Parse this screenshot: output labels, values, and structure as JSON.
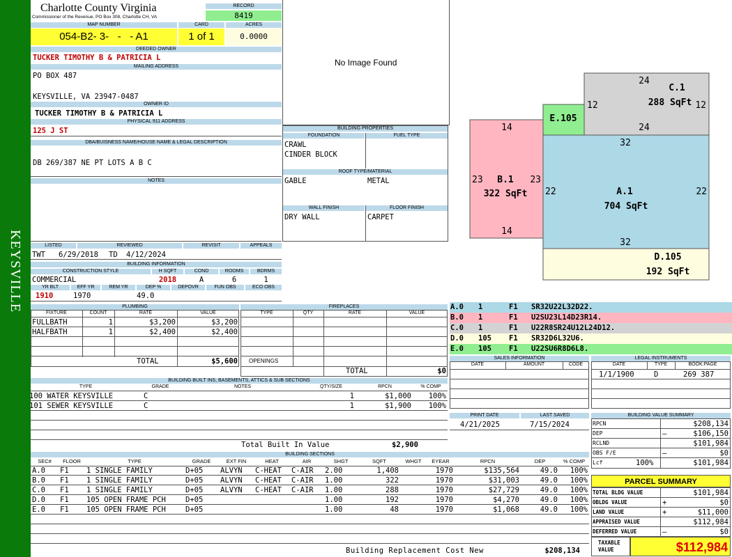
{
  "sidebar": {
    "label": "KEYSVILLE"
  },
  "header": {
    "county": "Charlotte County Virginia",
    "commissioner": "Commissioner of the Revenue, PO Box 308, Charlotte CH, VA",
    "record_label": "RECORD",
    "record": "8419",
    "map_label": "MAP NUMBER",
    "map_number": "054-B2- 3-   -   - A1",
    "card_label": "CARD",
    "card": "1 of 1",
    "acres_label": "ACRES",
    "acres": "0.0000"
  },
  "owner": {
    "deeded_label": "DEEDED OWNER",
    "deeded": "TUCKER TIMOTHY B & PATRICIA L",
    "mailing_label": "MAILING ADDRESS",
    "mailing_line1": "PO BOX 487",
    "mailing_line2": "KEYSVILLE, VA 23947-0487",
    "owner_id_label": "OWNER ID",
    "owner_id": "TUCKER TIMOTHY B & PATRICIA L",
    "physical_label": "PHYSICAL 911 ADDRESS",
    "physical": "125 J ST"
  },
  "legal": {
    "label": "DBA/BUISNESS NAME/HOUSE NAME & LEGAL DESCRIPTION",
    "text": "DB 269/387 NE PT LOTS A B C",
    "notes_label": "NOTES"
  },
  "photo": {
    "text": "No Image Found"
  },
  "building_props": {
    "label": "BUILDING PROPERTIES",
    "foundation_label": "FOUNDATION",
    "fuel_label": "FUEL TYPE",
    "foundation1": "CRAWL",
    "foundation2": "CINDER BLOCK",
    "roof_label": "ROOF TYPE/MATERIAL",
    "roof_type": "GABLE",
    "roof_material": "METAL",
    "wall_label": "WALL FINISH",
    "floor_label": "FLOOR FINISH",
    "wall": "DRY WALL",
    "floor": "CARPET"
  },
  "listed": {
    "listed_label": "LISTED",
    "reviewed_label": "REVIEWED",
    "revisit_label": "REVISIT",
    "appeals_label": "APPEALS",
    "listed_by": "TWT",
    "listed_date": "6/29/2018",
    "reviewed_by": "TD",
    "reviewed_date": "4/12/2024"
  },
  "building_info": {
    "label": "BUILDING INFORMATION",
    "style_label": "CONSTRUCTION STYLE",
    "hsqft_label": "H SQFT",
    "cond_label": "COND",
    "rooms_label": "ROOMS",
    "bdrms_label": "BDRMS",
    "style": "COMMERCIAL",
    "hsqft": "2018",
    "cond": "A",
    "rooms": "6",
    "bdrms": "1",
    "yrblt_label": "YR BLT",
    "effyr_label": "EFF YR",
    "remyr_label": "REM YR",
    "dep_label": "DEP %",
    "depovr_label": "DEPOVR",
    "funobs_label": "FUN OBS",
    "ecoobs_label": "ECO OBS",
    "yrblt": "1910",
    "effyr": "1970",
    "dep": "49.0"
  },
  "plumbing": {
    "label": "PLUMBING",
    "headers": [
      "FIXTURE",
      "COUNT",
      "RATE",
      "VALUE"
    ],
    "rows": [
      [
        "FULLBATH",
        "1",
        "$3,200",
        "$3,200"
      ],
      [
        "HALFBATH",
        "1",
        "$2,400",
        "$2,400"
      ]
    ],
    "total_label": "TOTAL",
    "total": "$5,600"
  },
  "fireplaces": {
    "label": "FIREPLACES",
    "headers": [
      "TYPE",
      "QTY",
      "RATE",
      "VALUE"
    ],
    "openings_label": "OPENINGS",
    "total_label": "TOTAL",
    "total": "$0"
  },
  "built_ins": {
    "label": "BUILDING BUILT INS, BASEMENTS, ATTICS & SUB SECTIONS",
    "headers": [
      "TYPE",
      "GRADE",
      "NOTES",
      "QTY/SIZE",
      "RPCN",
      "% COMP"
    ],
    "rows": [
      [
        "100 WATER KEYSVILLE",
        "C",
        "",
        "1",
        "$1,000",
        "100%"
      ],
      [
        "101 SEWER KEYSVILLE",
        "C",
        "",
        "1",
        "$1,900",
        "100%"
      ]
    ],
    "total_label": "Total Built In Value",
    "total": "$2,900"
  },
  "sketch": {
    "sections": [
      {
        "label": "A.1",
        "area": "704 SqFt",
        "top": "32",
        "bottom": "32",
        "left": "22",
        "right": "22",
        "color": "#add8e6"
      },
      {
        "label": "B.1",
        "area": "322 SqFt",
        "top": "14",
        "bottom": "14",
        "left": "23",
        "right": "23",
        "color": "#ffb6c1"
      },
      {
        "label": "C.1",
        "area": "288 SqFt",
        "top": "24",
        "bottom": "24",
        "left": "12",
        "right": "12",
        "color": "#d3d3d3"
      },
      {
        "label": "D.105",
        "area": "192 SqFt",
        "color": "#fffde0"
      },
      {
        "label": "E.105",
        "area": "",
        "color": "#90ee90"
      }
    ]
  },
  "sketch_legend": [
    {
      "code": "A.0",
      "n": "1",
      "f": "F1",
      "desc": "SR32U22L32D22.",
      "color": "#add8e6"
    },
    {
      "code": "B.0",
      "n": "1",
      "f": "F1",
      "desc": "U2SU23L14D23R14.",
      "color": "#ffb6c1"
    },
    {
      "code": "C.0",
      "n": "1",
      "f": "F1",
      "desc": "U22R8SR24U12L24D12.",
      "color": "#d3d3d3"
    },
    {
      "code": "D.0",
      "n": "105",
      "f": "F1",
      "desc": "SR32D6L32U6.",
      "color": "#fffde0"
    },
    {
      "code": "E.0",
      "n": "105",
      "f": "F1",
      "desc": "U22SU6R8D6L8.",
      "color": "#90ee90"
    }
  ],
  "sales": {
    "label": "SALES INFORMATION",
    "headers": [
      "DATE",
      "AMOUNT",
      "CODE"
    ]
  },
  "legal_instruments": {
    "label": "LEGAL INSTRUMENTS",
    "headers": [
      "DATE",
      "TYPE",
      "BOOK:PAGE"
    ],
    "date": "1/1/1900",
    "type": "D",
    "bookpage": "269 387"
  },
  "dates": {
    "print_label": "PRINT DATE",
    "saved_label": "LAST SAVED",
    "print": "4/21/2025",
    "saved": "7/15/2024"
  },
  "value_summary": {
    "label": "BUILDING VALUE SUMMARY",
    "rpcn_label": "RPCN",
    "rpcn": "$208,134",
    "dep_label": "DEP",
    "dep_sign": "–",
    "dep": "$106,150",
    "rclnd_label": "RCLND",
    "rclnd": "$101,984",
    "obs_label": "OBS F/E",
    "obs_sign": "–",
    "obs": "$0",
    "lcf_label": "Lcf",
    "lcf_pct": "100%",
    "lcf": "$101,984"
  },
  "parcel": {
    "label": "PARCEL SUMMARY",
    "bldg_label": "TOTAL BLDG VALUE",
    "bldg": "$101,984",
    "obldg_label": "OBLDG VALUE",
    "obldg_sign": "+",
    "obldg": "$0",
    "land_label": "LAND VALUE",
    "land_sign": "+",
    "land": "$11,000",
    "appraised_label": "APPRAISED VALUE",
    "appraised": "$112,984",
    "deferred_label": "DEFERRED VALUE",
    "deferred_sign": "–",
    "deferred": "$0",
    "taxable_label1": "TAXABLE",
    "taxable_label2": "VALUE",
    "taxable": "$112,984"
  },
  "sections": {
    "label": "BUILDING SECTIONS",
    "headers": [
      "SEC#",
      "FLOOR",
      "TYPE",
      "GRADE",
      "EXT FIN",
      "HEAT",
      "AIR",
      "SHGT",
      "SQFT",
      "WHGT",
      "EYEAR",
      "RPCN",
      "DEP",
      "% COMP"
    ],
    "rows": [
      [
        "A.0",
        "F1",
        "1 SINGLE FAMILY",
        "D+05",
        "ALVYN",
        "C-HEAT",
        "C-AIR",
        "2.00",
        "1,408",
        "",
        "1970",
        "$135,564",
        "49.0",
        "100%"
      ],
      [
        "B.0",
        "F1",
        "1 SINGLE FAMILY",
        "D+05",
        "ALVYN",
        "C-HEAT",
        "C-AIR",
        "1.00",
        "322",
        "",
        "1970",
        "$31,003",
        "49.0",
        "100%"
      ],
      [
        "C.0",
        "F1",
        "1 SINGLE FAMILY",
        "D+05",
        "ALVYN",
        "C-HEAT",
        "C-AIR",
        "1.00",
        "288",
        "",
        "1970",
        "$27,729",
        "49.0",
        "100%"
      ],
      [
        "D.0",
        "F1",
        "105 OPEN FRAME PCH",
        "D+05",
        "",
        "",
        "",
        "1.00",
        "192",
        "",
        "1970",
        "$4,270",
        "49.0",
        "100%"
      ],
      [
        "E.0",
        "F1",
        "105 OPEN FRAME PCH",
        "D+05",
        "",
        "",
        "",
        "1.00",
        "48",
        "",
        "1970",
        "$1,068",
        "49.0",
        "100%"
      ]
    ],
    "total_label": "Building Replacement Cost New",
    "total": "$208,134"
  }
}
